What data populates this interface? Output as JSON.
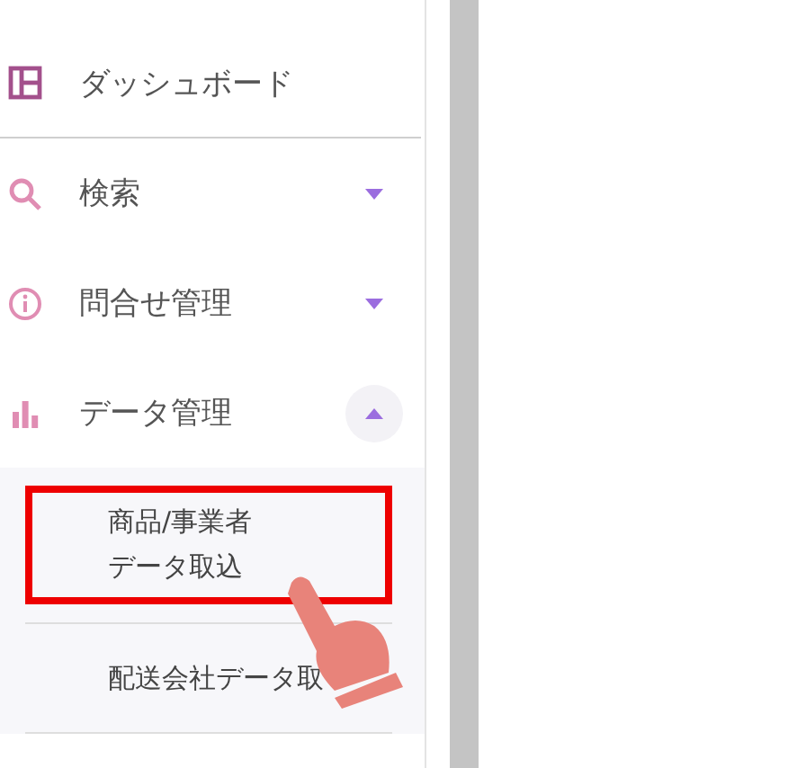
{
  "sidebar": {
    "items": [
      {
        "label": "ダッシュボード",
        "kind": "link"
      },
      {
        "label": "検索",
        "kind": "group",
        "expanded": false
      },
      {
        "label": "問合せ管理",
        "kind": "group",
        "expanded": false
      },
      {
        "label": "データ管理",
        "kind": "group",
        "expanded": true,
        "children": [
          {
            "label": "商品/事業者データ取込",
            "highlighted": true
          },
          {
            "label": "配送会社データ取",
            "highlighted": false
          }
        ]
      }
    ]
  }
}
